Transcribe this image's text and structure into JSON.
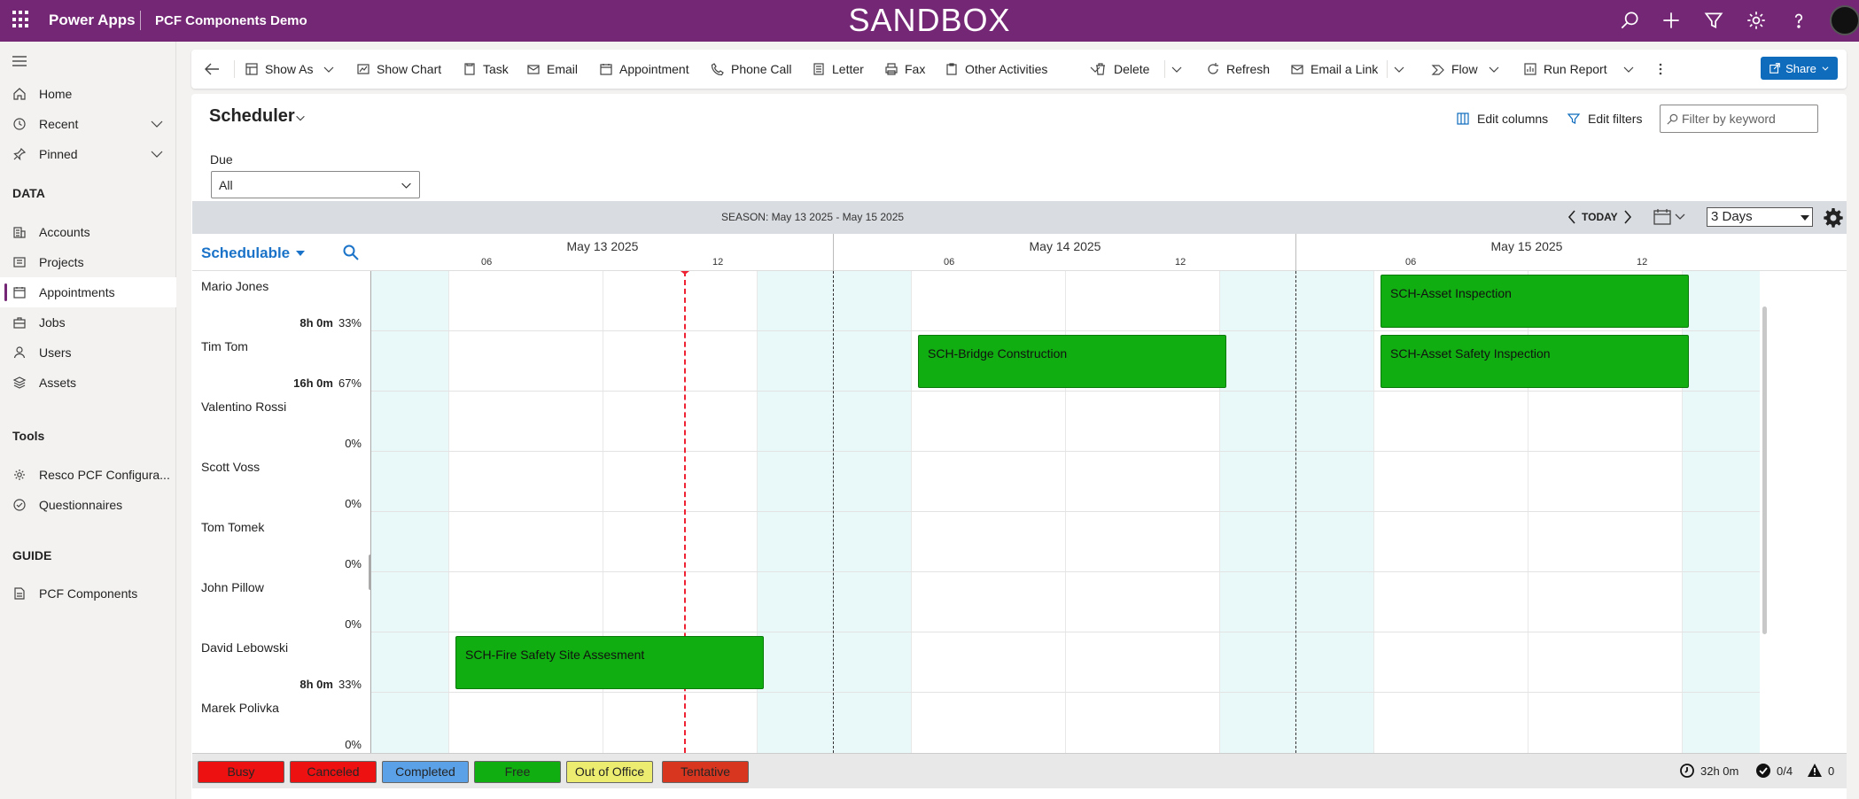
{
  "topbar": {
    "app_label": "Power Apps",
    "app_name": "PCF Components Demo",
    "environment_banner": "SANDBOX"
  },
  "nav": {
    "items": [
      {
        "label": "Home"
      },
      {
        "label": "Recent"
      },
      {
        "label": "Pinned"
      }
    ],
    "data_group": "DATA",
    "data_items": [
      {
        "label": "Accounts"
      },
      {
        "label": "Projects"
      },
      {
        "label": "Appointments",
        "active": true
      },
      {
        "label": "Jobs"
      },
      {
        "label": "Users"
      },
      {
        "label": "Assets"
      }
    ],
    "tools_group": "Tools",
    "tools_items": [
      {
        "label": "Resco PCF Configura..."
      },
      {
        "label": "Questionnaires"
      }
    ],
    "guide_group": "GUIDE",
    "guide_items": [
      {
        "label": "PCF Components"
      }
    ]
  },
  "commands": {
    "show_as": "Show As",
    "show_chart": "Show Chart",
    "task": "Task",
    "email": "Email",
    "appointment": "Appointment",
    "phone_call": "Phone Call",
    "letter": "Letter",
    "fax": "Fax",
    "other_activities": "Other Activities",
    "delete": "Delete",
    "refresh": "Refresh",
    "email_link": "Email a Link",
    "flow": "Flow",
    "run_report": "Run Report",
    "share": "Share"
  },
  "view": {
    "title": "Scheduler",
    "edit_columns": "Edit columns",
    "edit_filters": "Edit filters",
    "filter_placeholder": "Filter by keyword",
    "due_label": "Due",
    "due_value": "All"
  },
  "scheduler": {
    "season": "SEASON: May 13 2025 - May 15 2025",
    "today": "TODAY",
    "range": "3 Days",
    "resource_header": "Schedulable",
    "days": [
      {
        "label": "May 13 2025",
        "hours": [
          "06",
          "12"
        ]
      },
      {
        "label": "May 14 2025",
        "hours": [
          "06",
          "12"
        ]
      },
      {
        "label": "May 15 2025",
        "hours": [
          "06",
          "12"
        ]
      }
    ],
    "resources": [
      {
        "name": "Mario Jones",
        "hours": "8h 0m",
        "pct": "33%"
      },
      {
        "name": "Tim Tom",
        "hours": "16h 0m",
        "pct": "67%"
      },
      {
        "name": "Valentino Rossi",
        "hours": "",
        "pct": "0%"
      },
      {
        "name": "Scott Voss",
        "hours": "",
        "pct": "0%"
      },
      {
        "name": "Tom Tomek",
        "hours": "",
        "pct": "0%"
      },
      {
        "name": "John Pillow",
        "hours": "",
        "pct": "0%"
      },
      {
        "name": "David Lebowski",
        "hours": "8h 0m",
        "pct": "33%"
      },
      {
        "name": "Marek Polivka",
        "hours": "",
        "pct": "0%"
      }
    ],
    "events": [
      {
        "title": "SCH-Asset Inspection",
        "resource": "Mario Jones",
        "day": "May 15 2025",
        "start": "08:00",
        "end": "16:00"
      },
      {
        "title": "SCH-Bridge Construction",
        "resource": "Tim Tom",
        "day": "May 14 2025",
        "start": "08:00",
        "end": "16:00"
      },
      {
        "title": "SCH-Asset Safety Inspection",
        "resource": "Tim Tom",
        "day": "May 15 2025",
        "start": "08:00",
        "end": "16:00"
      },
      {
        "title": "SCH-Fire Safety Site Assesment",
        "resource": "David Lebowski",
        "day": "May 13 2025",
        "start": "08:00",
        "end": "16:00"
      }
    ],
    "legend": [
      {
        "label": "Busy",
        "color": "#ee1111"
      },
      {
        "label": "Canceled",
        "color": "#ee1111"
      },
      {
        "label": "Completed",
        "color": "#5aa1e8"
      },
      {
        "label": "Free",
        "color": "#10ae10"
      },
      {
        "label": "Out of Office",
        "color": "#ecec70"
      },
      {
        "label": "Tentative",
        "color": "#d9361f"
      }
    ],
    "summary": {
      "total_time": "32h 0m",
      "completed": "0/4",
      "warnings": "0"
    }
  },
  "colors": {
    "brand": "#742774",
    "accent": "#0f6cbd",
    "event_free": "#10ae10",
    "night_shade": "#e9f8f9"
  }
}
